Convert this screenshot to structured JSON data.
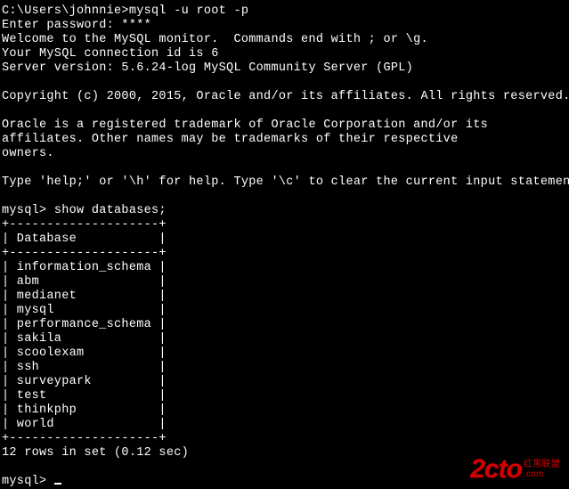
{
  "prompt_path": "C:\\Users\\johnnie>",
  "cmd_login": "mysql -u root -p",
  "enter_password": "Enter password: ****",
  "welcome": "Welcome to the MySQL monitor.  Commands end with ; or \\g.",
  "conn_id": "Your MySQL connection id is 6",
  "server_version": "Server version: 5.6.24-log MySQL Community Server (GPL)",
  "copyright": "Copyright (c) 2000, 2015, Oracle and/or its affiliates. All rights reserved.",
  "trademark1": "Oracle is a registered trademark of Oracle Corporation and/or its",
  "trademark2": "affiliates. Other names may be trademarks of their respective",
  "trademark3": "owners.",
  "help": "Type 'help;' or '\\h' for help. Type '\\c' to clear the current input statement.",
  "mysql_prompt": "mysql> ",
  "cmd_show": "show databases;",
  "table_border": "+--------------------+",
  "table_header": "| Database           |",
  "rows": [
    "| information_schema |",
    "| abm                |",
    "| medianet           |",
    "| mysql              |",
    "| performance_schema |",
    "| sakila             |",
    "| scoolexam          |",
    "| ssh                |",
    "| surveypark         |",
    "| test               |",
    "| thinkphp           |",
    "| world              |"
  ],
  "result_summary": "12 rows in set (0.12 sec)",
  "logo": {
    "main": "2cto",
    "sub1": "红黑联盟",
    "sub2": ".com"
  }
}
